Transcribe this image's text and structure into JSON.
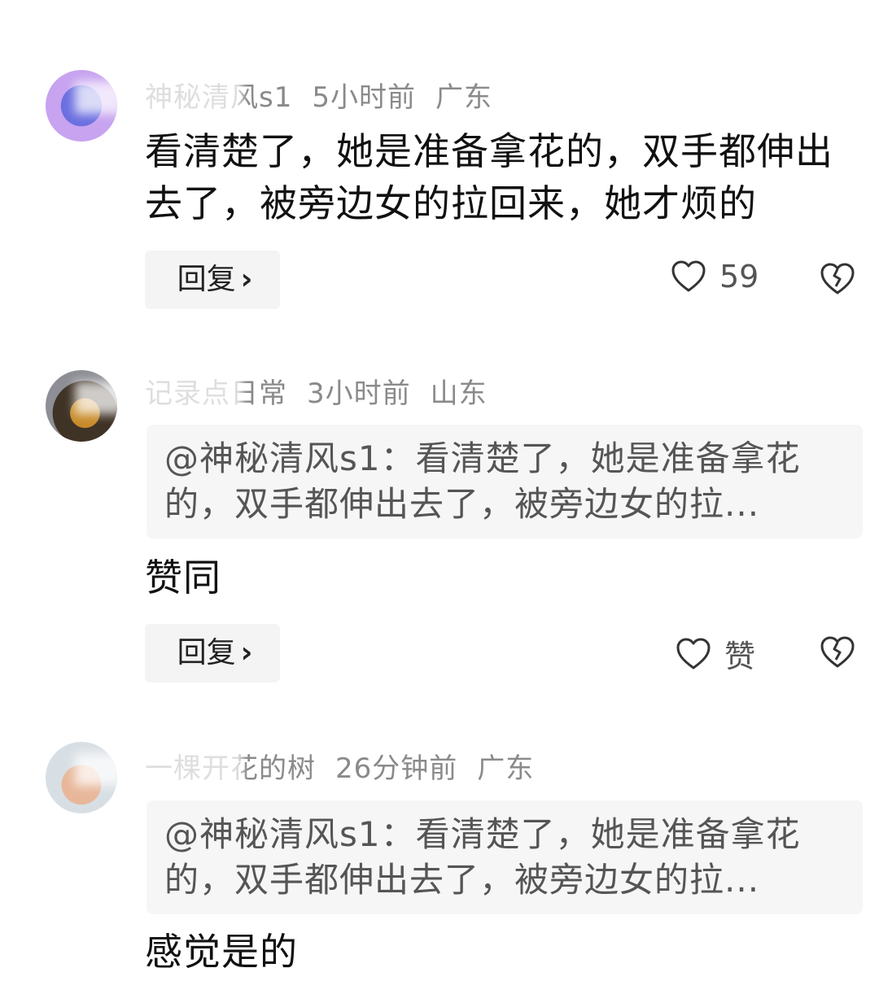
{
  "comments": [
    {
      "username": "神秘清风s1",
      "time": "5小时前",
      "location": "广东",
      "text": "看清楚了，她是准备拿花的，双手都伸出去了，被旁边女的拉回来，她才烦的",
      "reply_label": "回复",
      "like_count": "59"
    },
    {
      "username": "记录点日常",
      "time": "3小时前",
      "location": "山东",
      "quote": "@神秘清风s1：看清楚了，她是准备拿花的，双手都伸出去了，被旁边女的拉...",
      "text": "赞同",
      "reply_label": "回复",
      "like_label": "赞"
    },
    {
      "username": "一棵开花的树",
      "time": "26分钟前",
      "location": "广东",
      "quote": "@神秘清风s1：看清楚了，她是准备拿花的，双手都伸出去了，被旁边女的拉...",
      "text": "感觉是的"
    }
  ],
  "icons": {
    "like": "heart-outline-icon",
    "dislike": "broken-heart-icon",
    "reply_chevron": "chevron-right-icon"
  }
}
